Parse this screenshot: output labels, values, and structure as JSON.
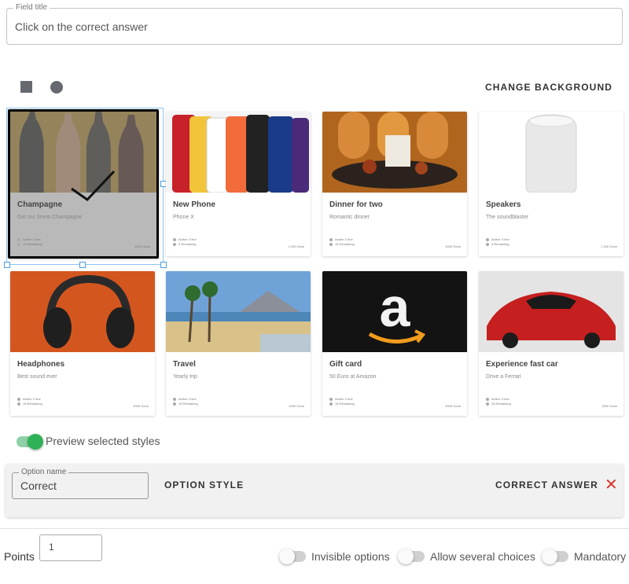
{
  "field": {
    "legend": "Field title",
    "value": "Click on the correct answer"
  },
  "toolbar": {
    "change_background": "CHANGE BACKGROUND"
  },
  "cards": [
    {
      "title": "Champagne",
      "subtitle": "Get our finest Champagne",
      "meta1": "Active: 0 line",
      "meta2": "15 Remaining",
      "gone": "1000 Gone"
    },
    {
      "title": "New Phone",
      "subtitle": "Phone X",
      "meta1": "Active: 0 line",
      "meta2": "3 Remaining",
      "gone": "1 200 Gone"
    },
    {
      "title": "Dinner for two",
      "subtitle": "Romantic dinner",
      "meta1": "Active: 0 line",
      "meta2": "15 Remaining",
      "gone": "1000 Gone"
    },
    {
      "title": "Speakers",
      "subtitle": "The soundblaster",
      "meta1": "Active: 0 line",
      "meta2": "3 Remaining",
      "gone": "1 200 Gone"
    },
    {
      "title": "Headphones",
      "subtitle": "Best sound ever",
      "meta1": "Active: 0 line",
      "meta2": "15 Remaining",
      "gone": "1000 Gone"
    },
    {
      "title": "Travel",
      "subtitle": "Yearly trip",
      "meta1": "Active: 0 line",
      "meta2": "15 Remaining",
      "gone": "1000 Gone"
    },
    {
      "title": "Gift card",
      "subtitle": "50 Euro at Amazon",
      "meta1": "Active: 0 line",
      "meta2": "15 Remaining",
      "gone": "1000 Gone"
    },
    {
      "title": "Experience fast car",
      "subtitle": "Drive a Ferrari",
      "meta1": "Active: 0 line",
      "meta2": "15 Remaining",
      "gone": "1000 Gone"
    }
  ],
  "preview": {
    "label": "Preview selected styles",
    "on": true
  },
  "option": {
    "name_legend": "Option name",
    "name_value": "Correct",
    "style_label": "OPTION STYLE",
    "correct_label": "CORRECT ANSWER",
    "close_glyph": "✕"
  },
  "points": {
    "label": "Points",
    "value": "1"
  },
  "toggles": {
    "invisible": "Invisible options",
    "several": "Allow several choices",
    "mandatory": "Mandatory"
  },
  "colors": {
    "accent_green": "#2fb157",
    "close_red": "#d9342b",
    "selection_blue": "#4a9fe0"
  }
}
